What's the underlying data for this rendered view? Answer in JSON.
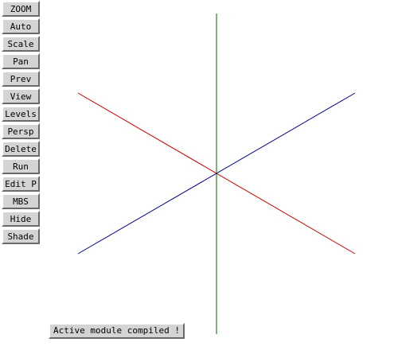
{
  "toolbar": {
    "buttons": [
      {
        "id": "zoom",
        "label": "ZOOM"
      },
      {
        "id": "auto",
        "label": "Auto"
      },
      {
        "id": "scale",
        "label": "Scale"
      },
      {
        "id": "pan",
        "label": "Pan"
      },
      {
        "id": "prev",
        "label": "Prev"
      },
      {
        "id": "view",
        "label": "View"
      },
      {
        "id": "levels",
        "label": "Levels"
      },
      {
        "id": "persp",
        "label": "Persp"
      },
      {
        "id": "delete",
        "label": "Delete"
      },
      {
        "id": "run",
        "label": "Run"
      },
      {
        "id": "edit-p",
        "label": "Edit P"
      },
      {
        "id": "mbs",
        "label": "MBS"
      },
      {
        "id": "hide",
        "label": "Hide"
      },
      {
        "id": "shade",
        "label": "Shade"
      }
    ]
  },
  "axes": {
    "x_axis_color": "#cc0000",
    "y_axis_color": "#00008b",
    "z_axis_color": "#006400"
  },
  "status": {
    "message": "Active module compiled !"
  }
}
